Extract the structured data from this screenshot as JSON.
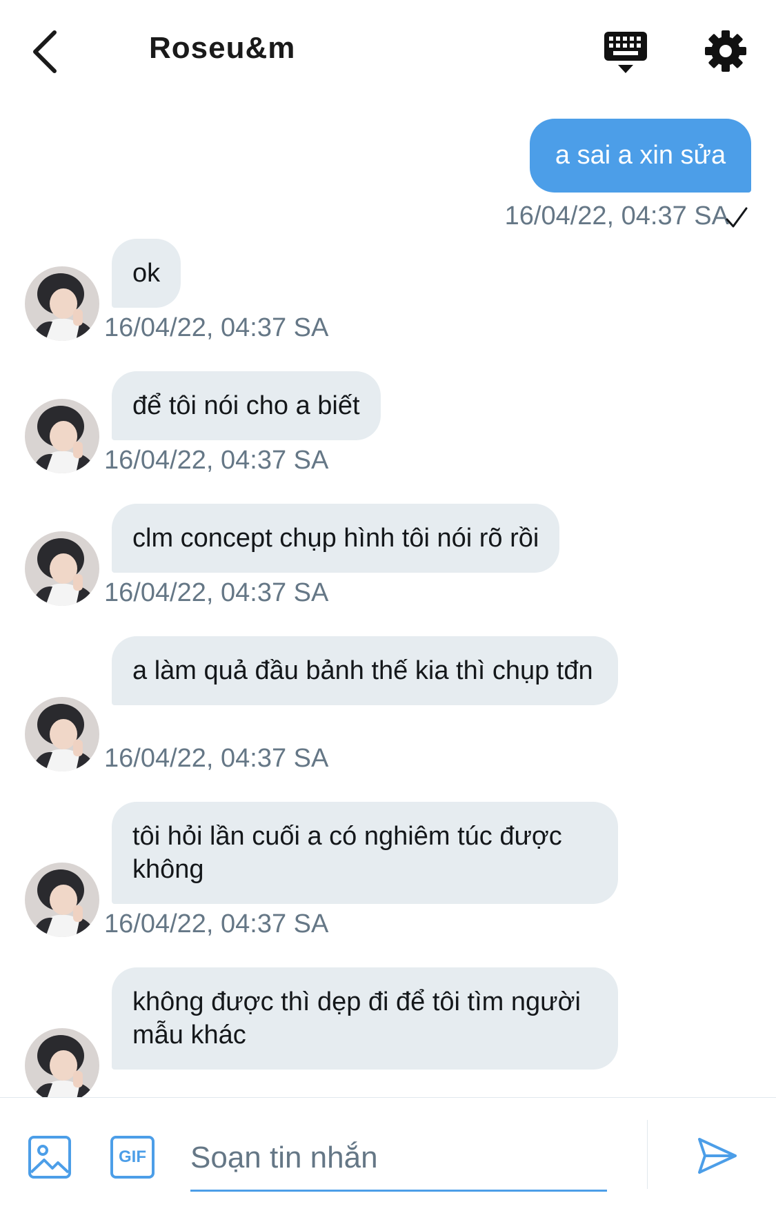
{
  "header": {
    "title": "Roseu&m",
    "back_icon": "chevron-left-icon",
    "keyboard_icon": "keyboard-icon",
    "settings_icon": "gear-icon"
  },
  "colors": {
    "accent": "#4c9ee8",
    "incoming_bubble": "#e6ecf0",
    "timestamp": "#657786"
  },
  "messages": [
    {
      "direction": "outgoing",
      "text": "a sai a xin sửa",
      "time": "16/04/22, 04:37 SA"
    },
    {
      "direction": "incoming",
      "text": "ok",
      "time": "16/04/22, 04:37 SA"
    },
    {
      "direction": "incoming",
      "text": "để tôi nói cho a biết",
      "time": "16/04/22, 04:37 SA"
    },
    {
      "direction": "incoming",
      "text": "clm concept chụp hình tôi nói rõ rồi",
      "time": "16/04/22, 04:37 SA"
    },
    {
      "direction": "incoming",
      "text": "a làm quả đầu bảnh thế kia thì chụp tđn",
      "time": "16/04/22, 04:37 SA"
    },
    {
      "direction": "incoming",
      "text": "tôi hỏi lần cuối a có nghiêm túc được không",
      "time": "16/04/22, 04:37 SA"
    },
    {
      "direction": "incoming",
      "text": "không được thì dẹp đi để tôi tìm người mẫu khác",
      "time": ""
    }
  ],
  "composer": {
    "placeholder": "Soạn tin nhắn",
    "gif_label": "GIF",
    "image_icon": "image-icon",
    "send_icon": "send-icon"
  }
}
